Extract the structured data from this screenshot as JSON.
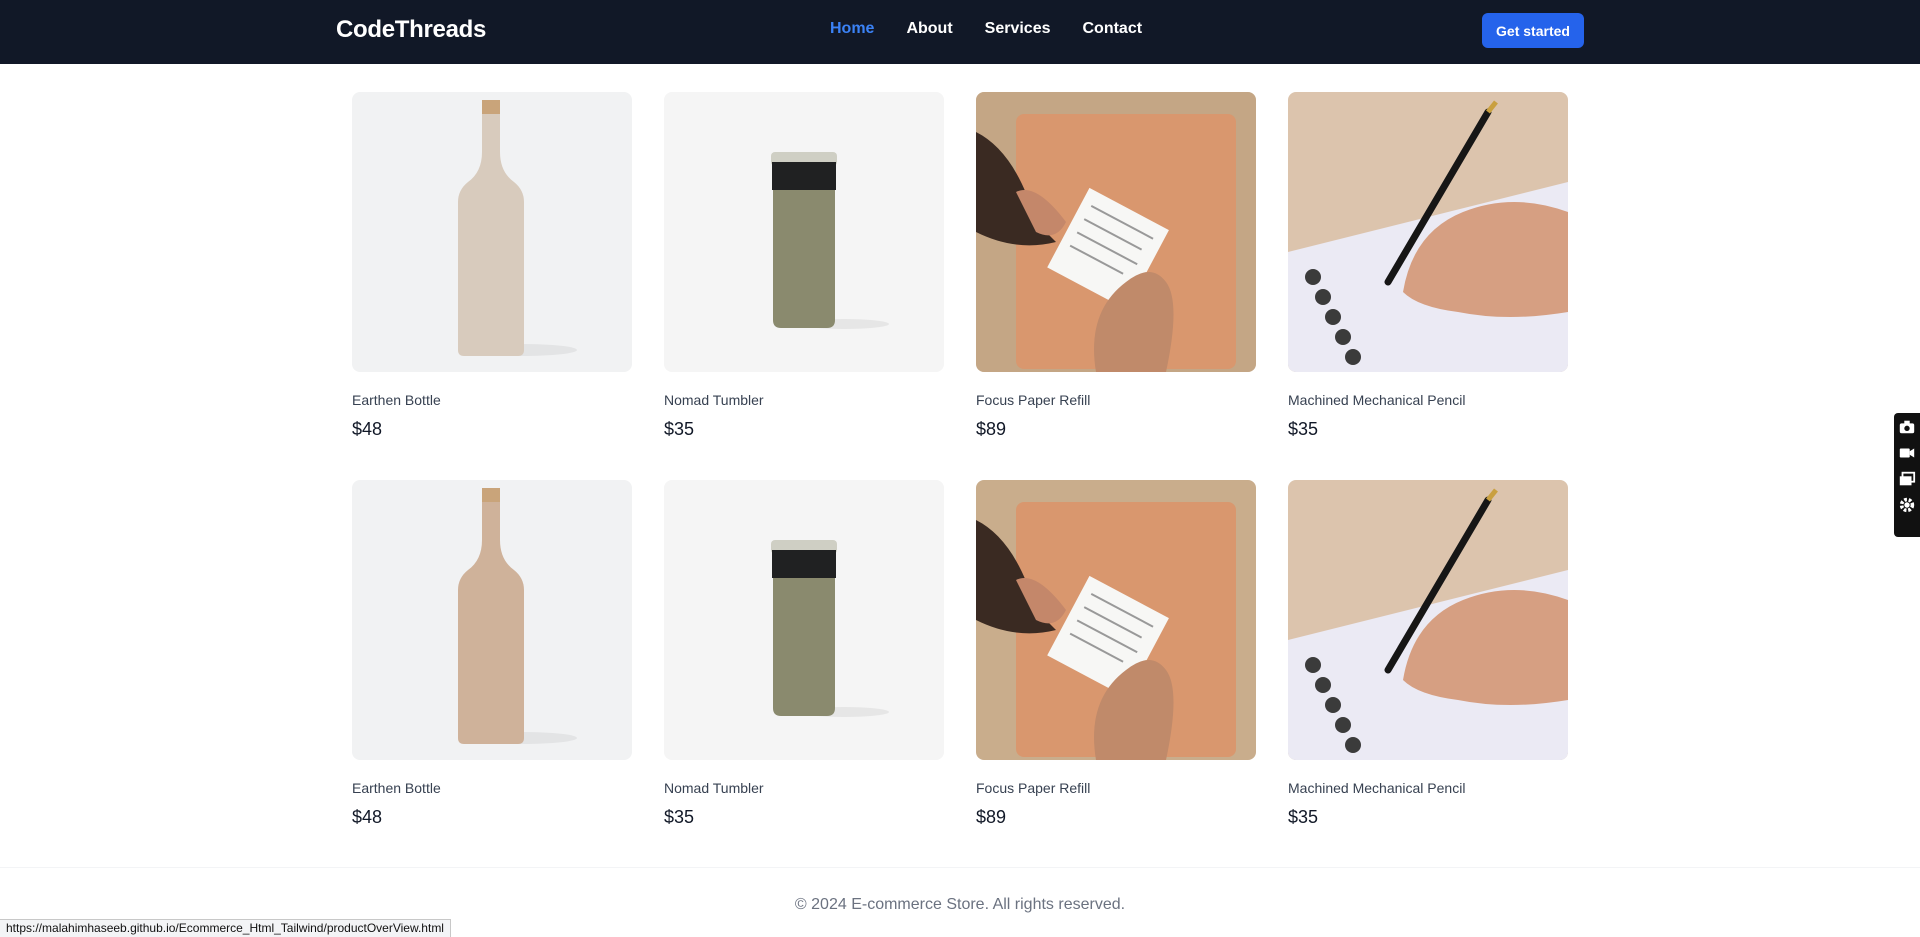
{
  "brand": "CodeThreads",
  "nav": {
    "links": [
      "Home",
      "About",
      "Services",
      "Contact"
    ],
    "active": "Home",
    "cta": "Get started"
  },
  "products": [
    {
      "name": "Earthen Bottle",
      "price": "$48",
      "image": "earthen-bottle"
    },
    {
      "name": "Nomad Tumbler",
      "price": "$35",
      "image": "nomad-tumbler"
    },
    {
      "name": "Focus Paper Refill",
      "price": "$89",
      "image": "focus-paper-refill"
    },
    {
      "name": "Machined Mechanical Pencil",
      "price": "$35",
      "image": "mechanical-pencil"
    },
    {
      "name": "Earthen Bottle",
      "price": "$48",
      "image": "earthen-bottle"
    },
    {
      "name": "Nomad Tumbler",
      "price": "$35",
      "image": "nomad-tumbler"
    },
    {
      "name": "Focus Paper Refill",
      "price": "$89",
      "image": "focus-paper-refill"
    },
    {
      "name": "Machined Mechanical Pencil",
      "price": "$35",
      "image": "mechanical-pencil"
    }
  ],
  "footer": "© 2024 E-commerce Store. All rights reserved.",
  "status_url": "https://malahimhaseeb.github.io/Ecommerce_Html_Tailwind/productOverView.html",
  "colors": {
    "nav_bg": "#111827",
    "accent": "#2563eb",
    "active_link": "#3b82f6"
  },
  "side_tools": [
    "camera-icon",
    "video-icon",
    "windows-icon",
    "settings-icon"
  ]
}
